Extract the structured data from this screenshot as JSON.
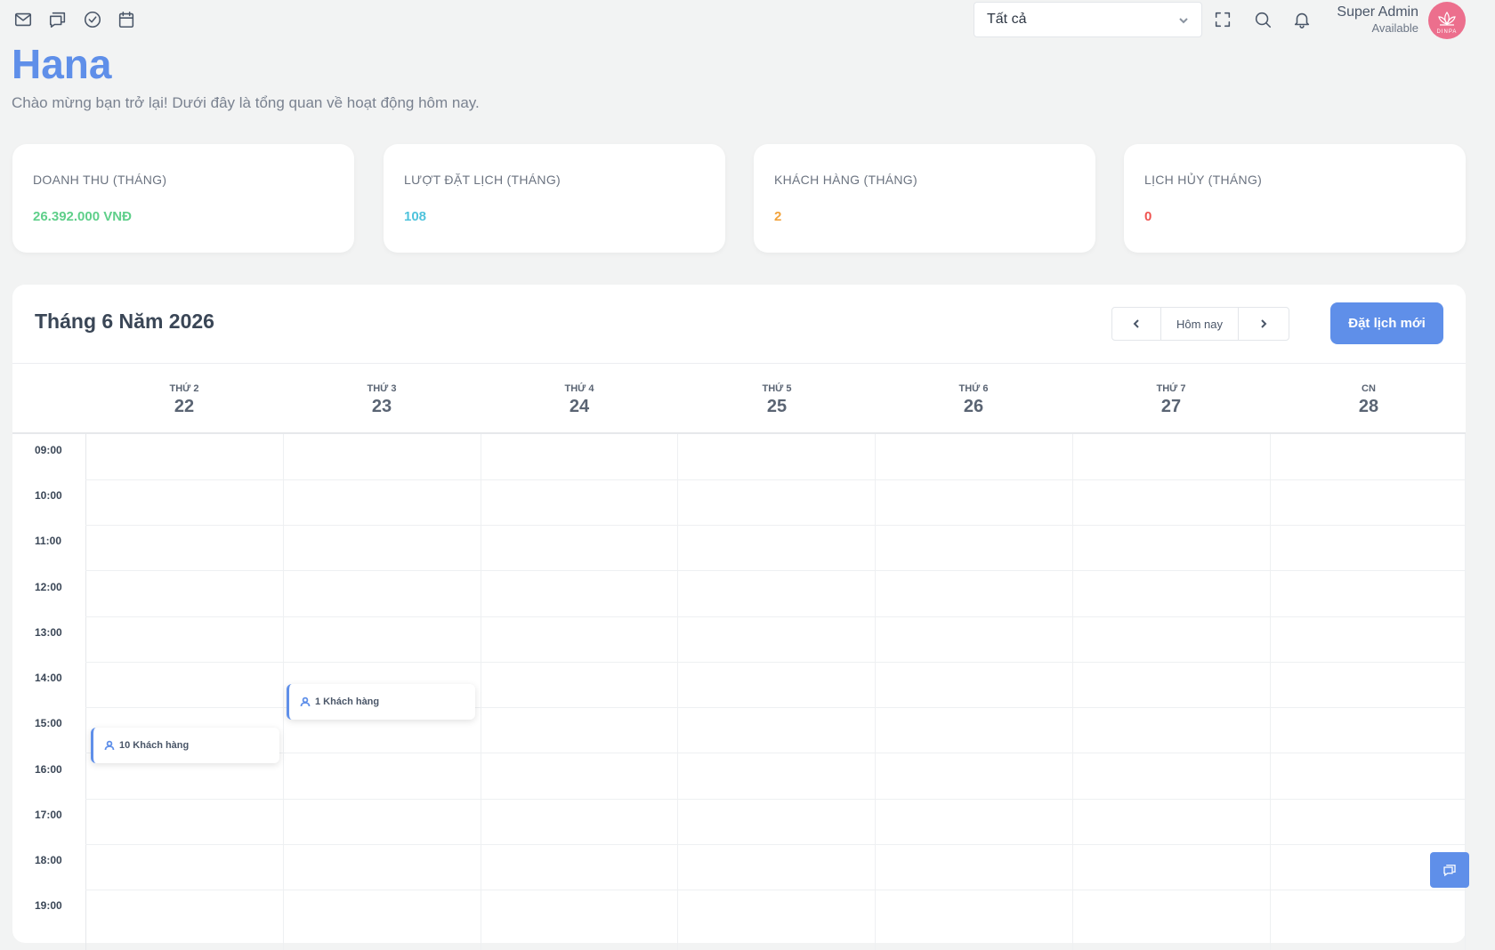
{
  "topbar": {
    "icons": [
      "mail-icon",
      "chat-icon",
      "check-circle-icon",
      "calendar-icon"
    ],
    "branch_select": "Tất cả",
    "user": {
      "name": "Super Admin",
      "status": "Available",
      "logo_text": "DINPA"
    }
  },
  "header": {
    "title": "Hana",
    "subtitle": "Chào mừng bạn trở lại! Dưới đây là tổng quan về hoạt động hôm nay."
  },
  "stats": [
    {
      "label": "DOANH THU (THÁNG)",
      "value": "26.392.000 VNĐ",
      "color": "#5fcf8a"
    },
    {
      "label": "LƯỢT ĐẶT LỊCH (THÁNG)",
      "value": "108",
      "color": "#4fc3dc"
    },
    {
      "label": "KHÁCH HÀNG (THÁNG)",
      "value": "2",
      "color": "#f2a33c"
    },
    {
      "label": "LỊCH HỦY (THÁNG)",
      "value": "0",
      "color": "#ef5350"
    }
  ],
  "calendar": {
    "title": "Tháng 6 Năm 2026",
    "today_label": "Hôm nay",
    "new_booking_label": "Đặt lịch mới",
    "days": [
      {
        "name": "THỨ 2",
        "date": "22"
      },
      {
        "name": "THỨ 3",
        "date": "23"
      },
      {
        "name": "THỨ 4",
        "date": "24"
      },
      {
        "name": "THỨ 5",
        "date": "25"
      },
      {
        "name": "THỨ 6",
        "date": "26"
      },
      {
        "name": "THỨ 7",
        "date": "27"
      },
      {
        "name": "CN",
        "date": "28"
      }
    ],
    "times": [
      "09:00",
      "10:00",
      "11:00",
      "12:00",
      "13:00",
      "14:00",
      "15:00",
      "16:00",
      "17:00",
      "18:00",
      "19:00"
    ],
    "events": [
      {
        "label": "10 Khách hàng",
        "day": "22"
      },
      {
        "label": "1 Khách hàng",
        "day": "23"
      }
    ]
  }
}
